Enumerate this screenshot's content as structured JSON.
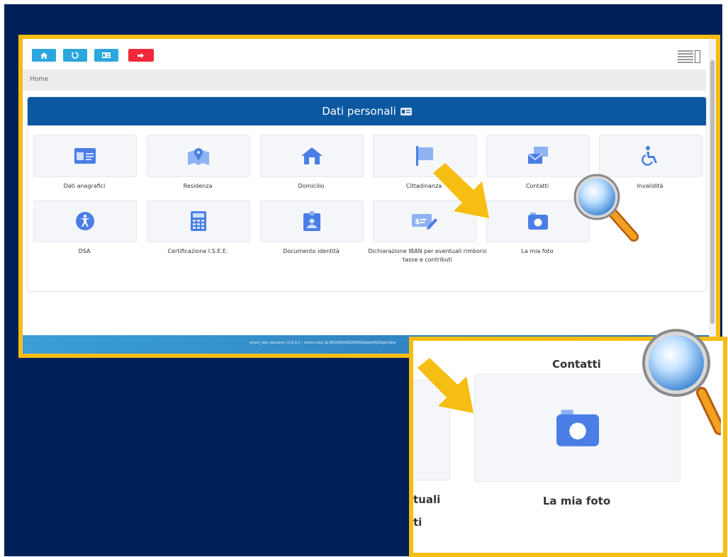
{
  "toolbar": {
    "buttons": [
      {
        "icon": "home-icon",
        "color": "#2ba6de"
      },
      {
        "icon": "history-icon",
        "color": "#2ba6de"
      },
      {
        "icon": "id-card-icon",
        "color": "#2ba6de"
      },
      {
        "icon": "logout-icon",
        "color": "#f0283c"
      }
    ]
  },
  "breadcrumb": "Home",
  "section": {
    "title": "Dati personali",
    "header_color": "#0b58a0"
  },
  "tiles": [
    {
      "label": "Dati anagrafici",
      "icon": "id-card-icon"
    },
    {
      "label": "Residenza",
      "icon": "map-marker-icon"
    },
    {
      "label": "Domicilio",
      "icon": "house-icon"
    },
    {
      "label": "Cittadinanza",
      "icon": "flag-icon"
    },
    {
      "label": "Contatti",
      "icon": "envelope-icon"
    },
    {
      "label": "Invalidità",
      "icon": "wheelchair-icon"
    },
    {
      "label": "DSA",
      "icon": "accessibility-icon"
    },
    {
      "label": "Certificazione I.S.E.E.",
      "icon": "calculator-icon"
    },
    {
      "label": "Documento identità",
      "icon": "badge-icon"
    },
    {
      "label": "Dichiarazione IBAN per eventuali rimborsi tasse e contributi",
      "icon": "money-check-icon"
    },
    {
      "label": "La mia foto",
      "icon": "camera-icon"
    }
  ],
  "footer": {
    "text": "smart_edu versione 12.0.0.1 - mario.rossi @ 6K1SSAV08Z0000/dbgGhHJ3hjpm3Jet"
  },
  "zoom": {
    "contatti_label": "Contatti",
    "photo_label": "La mia foto",
    "partial_line_1": "tuali",
    "partial_line_2": "ti"
  },
  "colors": {
    "highlight_frame": "#f6bd12",
    "background": "#00205a",
    "icon_blue": "#4a7ee6"
  }
}
